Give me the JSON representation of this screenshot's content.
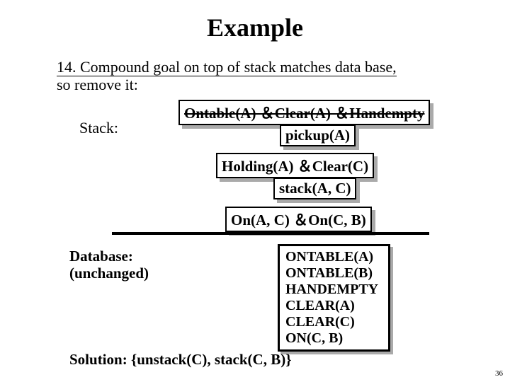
{
  "title": "Example",
  "step": {
    "text": "14. Compound goal on top of stack matches data base, so remove it:",
    "line1": "14. Compound goal on top of stack matches data base,",
    "line2": "so remove it:"
  },
  "stack": {
    "label": "Stack:",
    "compound": "Ontable(A) ＆Clear(A) ＆Handempty",
    "pickup": "pickup(A)",
    "holding": "Holding(A) ＆Clear(C)",
    "stackac": "stack(A, C)",
    "onac": "On(A, C) ＆On(C, B)"
  },
  "database": {
    "label1": "Database:",
    "label2": "(unchanged)",
    "facts": [
      "ONTABLE(A)",
      "ONTABLE(B)",
      "HANDEMPTY",
      "CLEAR(A)",
      "CLEAR(C)",
      "ON(C, B)"
    ]
  },
  "solution": "Solution: {unstack(C), stack(C, B)}",
  "pagenum": "36"
}
